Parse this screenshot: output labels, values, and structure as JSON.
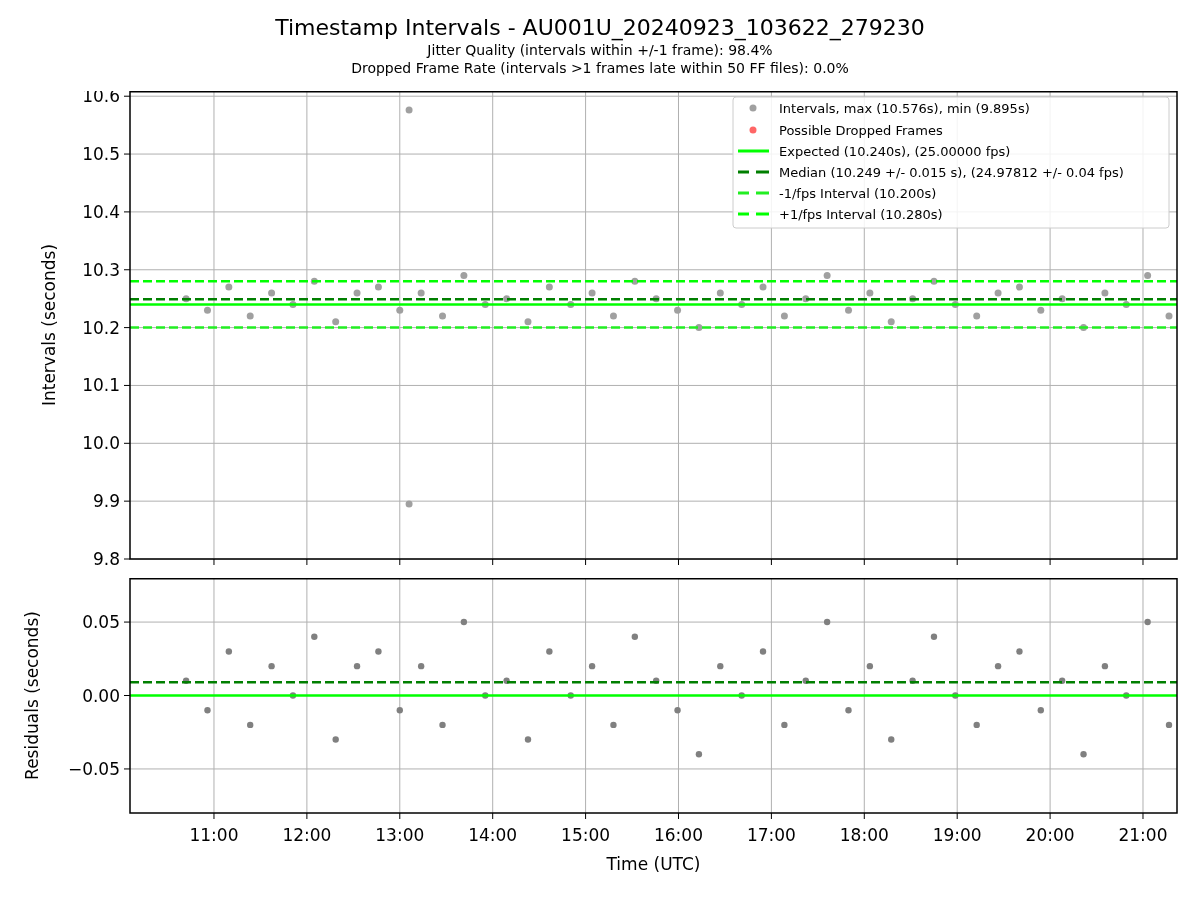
{
  "figure": {
    "title": "Timestamp Intervals - AU001U_20240923_103622_279230",
    "subtitles": [
      "Jitter Quality (intervals within +/-1 frame): 98.4%",
      "Dropped Frame Rate (intervals >1 frames late within 50 FF files): 0.0%"
    ],
    "extra_legend": [
      {
        "label": "Possible Dropped Frames",
        "color": "#ff6666"
      }
    ],
    "intervals_chart": {
      "chart_data": {
        "type": "scatter",
        "ylabel": "Intervals (seconds)",
        "grid": true,
        "legend": "upper right",
        "xlim": [
          10.096,
          21.366
        ],
        "ylim": [
          9.8,
          10.609
        ],
        "yticks": [
          {
            "value": 9.8,
            "label": "9.8"
          },
          {
            "value": 9.9,
            "label": "9.9"
          },
          {
            "value": 10.0,
            "label": "10.0"
          },
          {
            "value": 10.1,
            "label": "10.1"
          },
          {
            "value": 10.2,
            "label": "10.2"
          },
          {
            "value": 10.3,
            "label": "10.3"
          },
          {
            "value": 10.4,
            "label": "10.4"
          },
          {
            "value": 10.5,
            "label": "10.5"
          },
          {
            "value": 10.6,
            "label": "10.6"
          }
        ],
        "x": [
          10.7,
          10.93,
          11.16,
          11.39,
          11.62,
          11.85,
          12.08,
          12.31,
          12.54,
          12.77,
          13.0,
          13.23,
          13.46,
          13.69,
          13.92,
          14.15,
          14.38,
          14.61,
          14.84,
          15.07,
          15.3,
          15.53,
          15.76,
          15.99,
          16.22,
          16.45,
          16.68,
          16.91,
          17.14,
          17.37,
          17.6,
          17.83,
          18.06,
          18.29,
          18.52,
          18.75,
          18.98,
          19.21,
          19.44,
          19.67,
          19.9,
          20.13,
          20.36,
          20.59,
          20.82,
          21.05,
          21.28,
          13.1,
          13.1
        ],
        "series": [
          {
            "name": "Intervals, max (10.576s), min (9.895s)",
            "color": "#a0a0a0",
            "values": [
              10.25,
              10.23,
              10.27,
              10.22,
              10.26,
              10.24,
              10.28,
              10.21,
              10.26,
              10.27,
              10.23,
              10.26,
              10.22,
              10.29,
              10.24,
              10.25,
              10.21,
              10.27,
              10.24,
              10.26,
              10.22,
              10.28,
              10.25,
              10.23,
              10.2,
              10.26,
              10.24,
              10.27,
              10.22,
              10.25,
              10.29,
              10.23,
              10.26,
              10.21,
              10.25,
              10.28,
              10.24,
              10.22,
              10.26,
              10.27,
              10.23,
              10.25,
              10.2,
              10.26,
              10.24,
              10.29,
              10.22,
              10.576,
              9.895
            ]
          }
        ],
        "ref_lines": [
          {
            "axis": "y",
            "value": 10.24,
            "color": "#00ff00",
            "label": "Expected (10.240s), (25.00000 fps)"
          },
          {
            "axis": "y",
            "value": 10.249,
            "color": "#007f00",
            "label": "Median (10.249 +/- 0.015 s), (24.97812 +/- 0.04 fps)"
          },
          {
            "axis": "y",
            "value": 10.2,
            "color": "#22ee22",
            "label": "-1/fps Interval (10.200s)"
          },
          {
            "axis": "y",
            "value": 10.28,
            "color": "#00ff00",
            "label": "+1/fps Interval (10.280s)"
          }
        ]
      }
    },
    "residuals_chart": {
      "chart_data": {
        "type": "scatter",
        "xlabel": "Time (UTC)",
        "ylabel": "Residuals (seconds)",
        "grid": true,
        "xlim": [
          10.096,
          21.366
        ],
        "ylim": [
          -0.08,
          0.08
        ],
        "yticks": [
          {
            "value": -0.05,
            "label": "−0.05"
          },
          {
            "value": 0,
            "label": "0.00"
          },
          {
            "value": 0.05,
            "label": "0.05"
          }
        ],
        "xticks": [
          {
            "value": 11,
            "label": "11:00"
          },
          {
            "value": 12,
            "label": "12:00"
          },
          {
            "value": 13,
            "label": "13:00"
          },
          {
            "value": 14,
            "label": "14:00"
          },
          {
            "value": 15,
            "label": "15:00"
          },
          {
            "value": 16,
            "label": "16:00"
          },
          {
            "value": 17,
            "label": "17:00"
          },
          {
            "value": 18,
            "label": "18:00"
          },
          {
            "value": 19,
            "label": "19:00"
          },
          {
            "value": 20,
            "label": "20:00"
          },
          {
            "value": 21,
            "label": "21:00"
          }
        ],
        "x": [
          10.7,
          10.93,
          11.16,
          11.39,
          11.62,
          11.85,
          12.08,
          12.31,
          12.54,
          12.77,
          13.0,
          13.23,
          13.46,
          13.69,
          13.92,
          14.15,
          14.38,
          14.61,
          14.84,
          15.07,
          15.3,
          15.53,
          15.76,
          15.99,
          16.22,
          16.45,
          16.68,
          16.91,
          17.14,
          17.37,
          17.6,
          17.83,
          18.06,
          18.29,
          18.52,
          18.75,
          18.98,
          19.21,
          19.44,
          19.67,
          19.9,
          20.13,
          20.36,
          20.59,
          20.82,
          21.05,
          21.28
        ],
        "series": [
          {
            "color": "#808080",
            "values": [
              0.01,
              -0.01,
              0.03,
              -0.02,
              0.02,
              0.0,
              0.04,
              -0.03,
              0.02,
              0.03,
              -0.01,
              0.02,
              -0.02,
              0.05,
              0.0,
              0.01,
              -0.03,
              0.03,
              0.0,
              0.02,
              -0.02,
              0.04,
              0.01,
              -0.01,
              -0.04,
              0.02,
              0.0,
              0.03,
              -0.02,
              0.01,
              0.05,
              -0.01,
              0.02,
              -0.03,
              0.01,
              0.04,
              0.0,
              -0.02,
              0.02,
              0.03,
              -0.01,
              0.01,
              -0.04,
              0.02,
              0.0,
              0.05,
              -0.02
            ]
          }
        ],
        "ref_lines": [
          {
            "axis": "y",
            "value": 0.009,
            "color": "#007f00"
          },
          {
            "axis": "y",
            "value": 0,
            "color": "#00ff00"
          }
        ]
      }
    }
  }
}
